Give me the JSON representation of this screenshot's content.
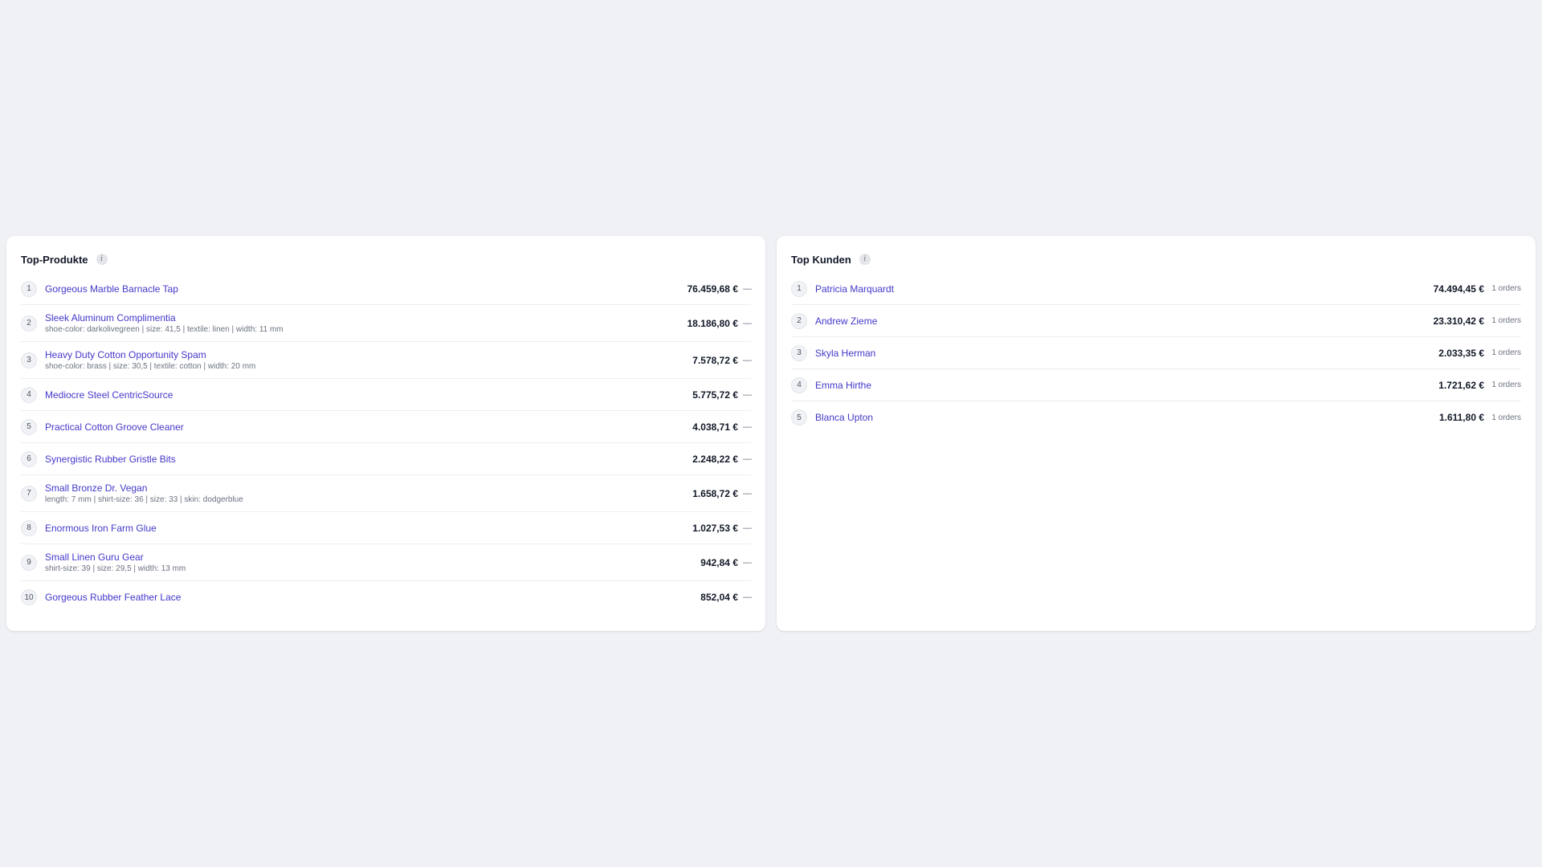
{
  "top_products": {
    "title": "Top-Produkte",
    "info_icon": "info-icon",
    "items": [
      {
        "rank": "1",
        "name": "Gorgeous Marble Barnacle Tap",
        "variant": "",
        "amount": "76.459,68 €",
        "trend": "—"
      },
      {
        "rank": "2",
        "name": "Sleek Aluminum Complimentia",
        "variant": "shoe-color: darkolivegreen | size: 41,5 | textile: linen | width: 11 mm",
        "amount": "18.186,80 €",
        "trend": "—"
      },
      {
        "rank": "3",
        "name": "Heavy Duty Cotton Opportunity Spam",
        "variant": "shoe-color: brass | size: 30,5 | textile: cotton | width: 20 mm",
        "amount": "7.578,72 €",
        "trend": "—"
      },
      {
        "rank": "4",
        "name": "Mediocre Steel CentricSource",
        "variant": "",
        "amount": "5.775,72 €",
        "trend": "—"
      },
      {
        "rank": "5",
        "name": "Practical Cotton Groove Cleaner",
        "variant": "",
        "amount": "4.038,71 €",
        "trend": "—"
      },
      {
        "rank": "6",
        "name": "Synergistic Rubber Gristle Bits",
        "variant": "",
        "amount": "2.248,22 €",
        "trend": "—"
      },
      {
        "rank": "7",
        "name": "Small Bronze Dr. Vegan",
        "variant": "length: 7 mm | shirt-size: 36 | size: 33 | skin: dodgerblue",
        "amount": "1.658,72 €",
        "trend": "—"
      },
      {
        "rank": "8",
        "name": "Enormous Iron Farm Glue",
        "variant": "",
        "amount": "1.027,53 €",
        "trend": "—"
      },
      {
        "rank": "9",
        "name": "Small Linen Guru Gear",
        "variant": "shirt-size: 39 | size: 29,5 | width: 13 mm",
        "amount": "942,84 €",
        "trend": "—"
      },
      {
        "rank": "10",
        "name": "Gorgeous Rubber Feather Lace",
        "variant": "",
        "amount": "852,04 €",
        "trend": "—"
      }
    ]
  },
  "top_customers": {
    "title": "Top Kunden",
    "info_icon": "info-icon",
    "items": [
      {
        "rank": "1",
        "name": "Patricia Marquardt",
        "amount": "74.494,45 €",
        "orders": "1 orders"
      },
      {
        "rank": "2",
        "name": "Andrew Zieme",
        "amount": "23.310,42 €",
        "orders": "1 orders"
      },
      {
        "rank": "3",
        "name": "Skyla Herman",
        "amount": "2.033,35 €",
        "orders": "1 orders"
      },
      {
        "rank": "4",
        "name": "Emma Hirthe",
        "amount": "1.721,62 €",
        "orders": "1 orders"
      },
      {
        "rank": "5",
        "name": "Blanca Upton",
        "amount": "1.611,80 €",
        "orders": "1 orders"
      }
    ]
  },
  "colors": {
    "background": "#f0f1f5",
    "card": "#ffffff",
    "link": "#4338ca",
    "muted": "#6b7280"
  }
}
